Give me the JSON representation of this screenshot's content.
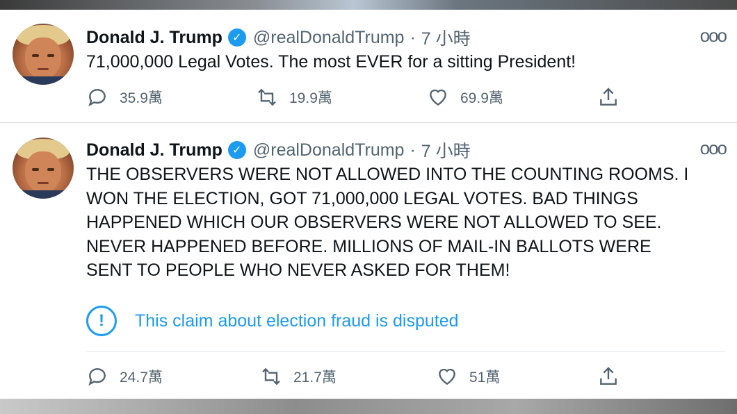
{
  "tweets": [
    {
      "author_name": "Donald J. Trump",
      "handle": "@realDonaldTrump",
      "separator": "·",
      "time": "7 小時",
      "more_icon": "ooo",
      "text": "71,000,000 Legal Votes. The most EVER for a sitting President!",
      "actions": {
        "replies": "35.9萬",
        "retweets": "19.9萬",
        "likes": "69.9萬"
      }
    },
    {
      "author_name": "Donald J. Trump",
      "handle": "@realDonaldTrump",
      "separator": "·",
      "time": "7 小時",
      "more_icon": "ooo",
      "text_lines": [
        "THE OBSERVERS WERE NOT ALLOWED INTO THE COUNTING ROOMS. I",
        "WON THE ELECTION, GOT 71,000,000 LEGAL VOTES. BAD THINGS",
        "HAPPENED WHICH OUR OBSERVERS WERE NOT ALLOWED TO SEE.",
        "NEVER HAPPENED BEFORE. MILLIONS OF MAIL-IN BALLOTS WERE",
        "SENT TO PEOPLE WHO NEVER ASKED FOR THEM!"
      ],
      "notice": {
        "icon": "!",
        "text": "This claim about election fraud is disputed"
      },
      "actions": {
        "replies": "24.7萬",
        "retweets": "21.7萬",
        "likes": "51萬"
      }
    }
  ],
  "colors": {
    "accent": "#1d9bf0",
    "secondary_text": "#536471",
    "primary_text": "#0f1419"
  }
}
